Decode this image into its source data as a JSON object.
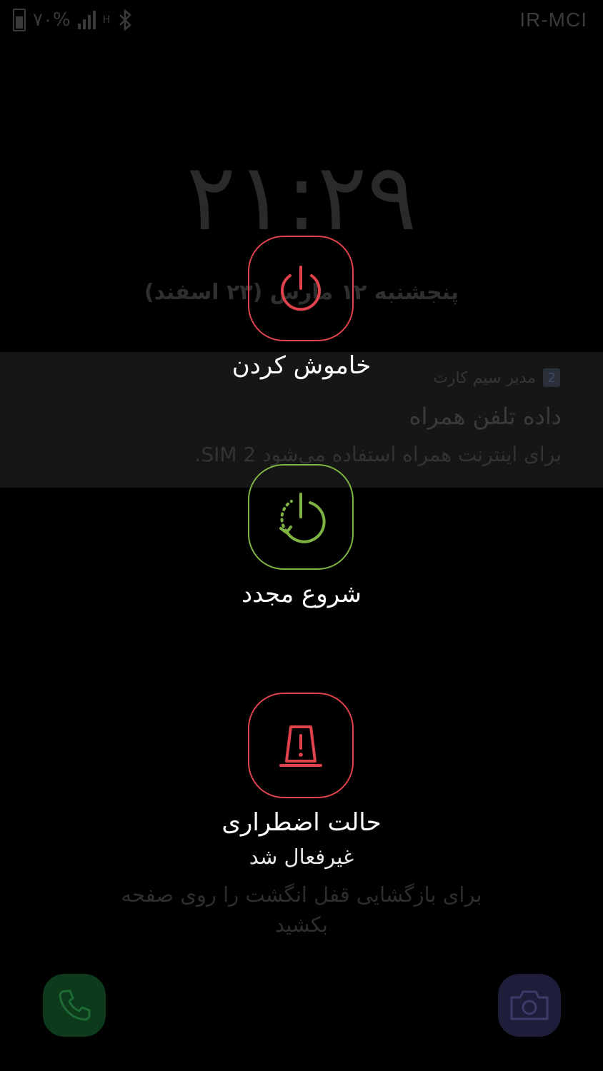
{
  "status_bar": {
    "battery_text": "۷۰%",
    "net_type": "H",
    "carrier": "IR-MCI"
  },
  "lockscreen": {
    "time": "۲۱:۲۹",
    "date": "پنجشنبه ۱۲ مارس (۲۳ اسفند)",
    "unlock_hint": "برای بازگشایی قفل انگشت را روی صفحه بکشید"
  },
  "notification": {
    "sim_number": "2",
    "app_name": "مدیر سیم کارت",
    "title": "داده تلفن همراه",
    "body": "برای اینترنت همراه استفاده می‌شود SIM 2."
  },
  "power_menu": {
    "power_off": "خاموش کردن",
    "restart": "شروع مجدد",
    "emergency": "حالت اضطراری",
    "emergency_status": "غیرفعال شد"
  },
  "colors": {
    "power_off": "#e0434b",
    "restart": "#7fb443",
    "emergency": "#e0434b"
  }
}
